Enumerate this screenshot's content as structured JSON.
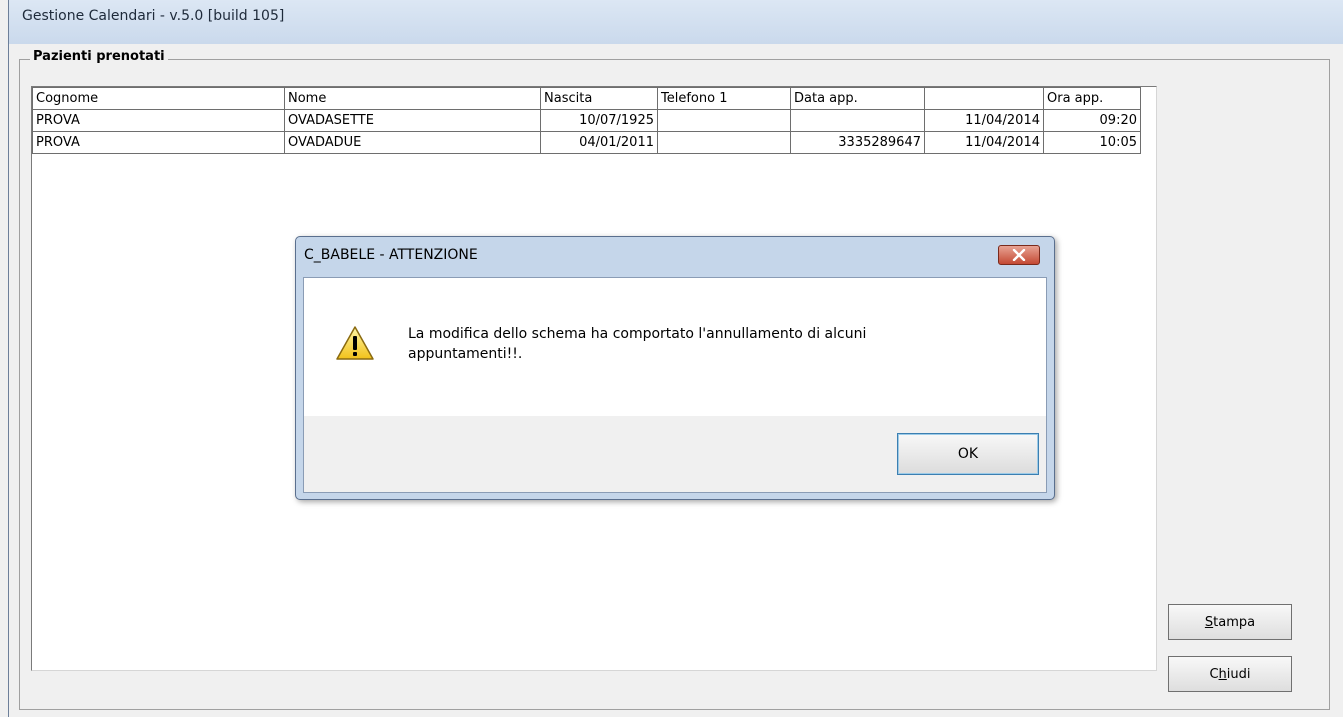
{
  "window": {
    "title": "Gestione Calendari    - v.5.0 [build 105]"
  },
  "group": {
    "label": "Pazienti prenotati"
  },
  "table": {
    "columns": [
      "Cognome",
      "Nome",
      "Nascita",
      "Telefono 1",
      "Data app.",
      "",
      "Ora app."
    ],
    "rows": [
      [
        "PROVA",
        "OVADASETTE",
        "10/07/1925",
        "",
        "",
        "11/04/2014",
        "09:20"
      ],
      [
        "PROVA",
        "OVADADUE",
        "04/01/2011",
        "",
        "3335289647",
        "11/04/2014",
        "10:05"
      ]
    ]
  },
  "buttons": {
    "stampa_prefix": "S",
    "stampa_rest": "tampa",
    "chiudi_prefix": "C",
    "chiudi_underlined": "h",
    "chiudi_rest": "iudi"
  },
  "dialog": {
    "title": "C_BABELE - ATTENZIONE",
    "message_line1": "La modifica dello schema ha comportato l'annullamento di alcuni",
    "message_line2": "appuntamenti!!.",
    "ok_label": "OK",
    "icon": "warning-icon",
    "close_icon": "close-icon",
    "close_color": "#c44a34"
  }
}
